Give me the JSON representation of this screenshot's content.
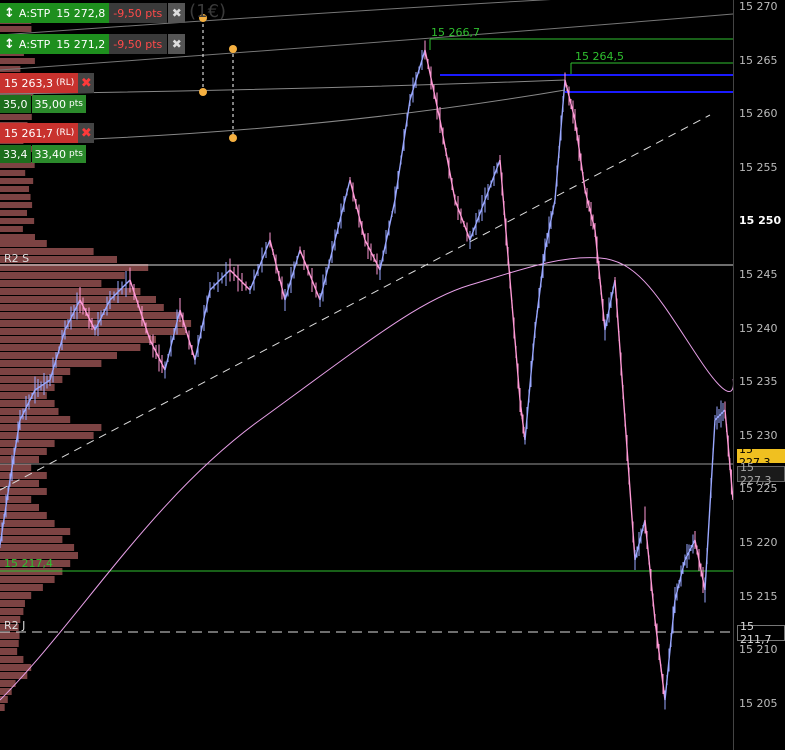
{
  "title_fragment": "h (1€)",
  "orders": [
    {
      "type": "A:STP",
      "price": "15 272,8",
      "pts": "-9,50 pts"
    },
    {
      "type": "A:STP",
      "price": "15 271,2",
      "pts": "-9,50 pts"
    }
  ],
  "rl_orders": [
    {
      "price": "15 263,3",
      "tag": "(RL)",
      "pts_a": "35,0",
      "pts_b": "35,00",
      "pts_unit": "pts"
    },
    {
      "price": "15 261,7",
      "tag": "(RL)",
      "pts_a": "33,4",
      "pts_b": "33,40",
      "pts_unit": "pts"
    }
  ],
  "levels": {
    "r2s": "R2 S",
    "r2j": "R2 J",
    "green_low": "15 217,4",
    "green_high1": "15 266,7",
    "green_high2": "15 264,5"
  },
  "axis": {
    "ticks": [
      "15 270",
      "15 265",
      "15 260",
      "15 255",
      "15 250",
      "15 245",
      "15 240",
      "15 235",
      "15 230",
      "15 225",
      "15 220",
      "15 215",
      "15 210",
      "15 205"
    ],
    "bold_tick": "15 250",
    "current_price": "15 227,3",
    "last_price": "15 227,3",
    "r2j_price": "15 211,7"
  },
  "colors": {
    "up": "#9aa8ff",
    "down": "#ff9ad6",
    "ma": "#e8a0e8",
    "profile": "#8a4a4a",
    "green_level": "#2fbf2f",
    "blue_level": "#1a1aff",
    "current_tag": "#f0c020"
  }
}
